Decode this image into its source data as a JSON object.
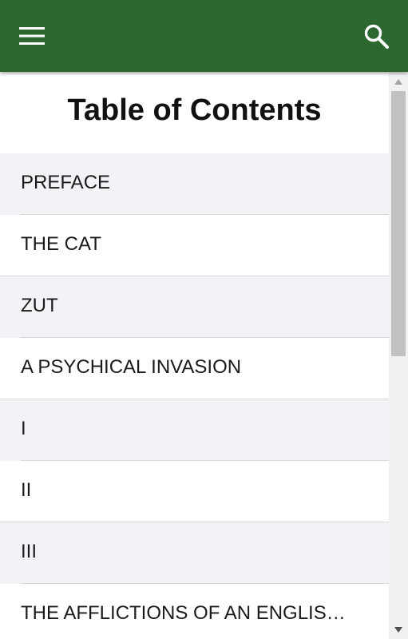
{
  "appbar": {
    "background_color": "#2e6630",
    "menu_icon": "hamburger-menu-icon",
    "search_icon": "search-icon"
  },
  "toc": {
    "title": "Table of Contents",
    "items": [
      {
        "label": "PREFACE"
      },
      {
        "label": "THE CAT"
      },
      {
        "label": "ZUT"
      },
      {
        "label": "A PSYCHICAL INVASION"
      },
      {
        "label": "I"
      },
      {
        "label": "II"
      },
      {
        "label": "III"
      },
      {
        "label": "THE AFFLICTIONS OF AN ENGLIS…"
      }
    ]
  },
  "scrollbar": {
    "icons": [
      "scroll-up-arrow-icon",
      "scroll-down-arrow-icon"
    ]
  }
}
